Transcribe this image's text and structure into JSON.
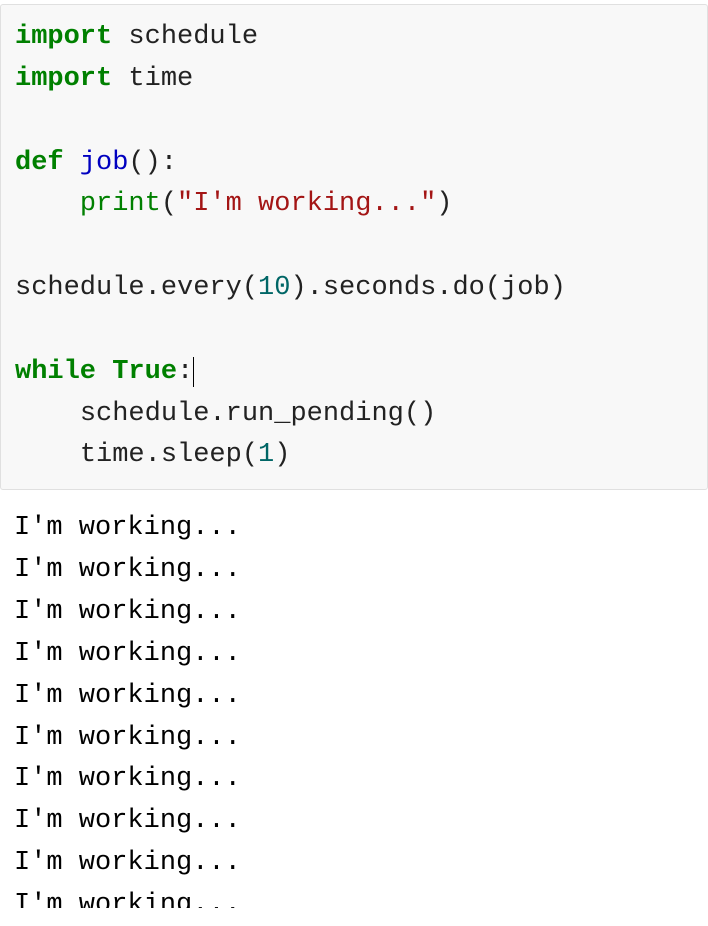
{
  "code": {
    "kw_import1": "import",
    "mod_schedule": " schedule",
    "kw_import2": "import",
    "mod_time": " time",
    "kw_def": "def",
    "fn_job": " job",
    "def_parens": "():",
    "indent1": "    ",
    "call_print": "print",
    "lparen1": "(",
    "str_msg": "\"I'm working...\"",
    "rparen1": ")",
    "sched_line": "schedule.every(",
    "num_ten": "10",
    "sched_line2": ").seconds.do(job)",
    "kw_while": "while",
    "sp_while": " ",
    "bool_true": "True",
    "colon_while": ":",
    "indent2a": "    ",
    "run_pending": "schedule.run_pending()",
    "indent2b": "    ",
    "sleep_pre": "time.sleep(",
    "num_one": "1",
    "sleep_post": ")"
  },
  "output": {
    "lines": [
      "I'm working...",
      "I'm working...",
      "I'm working...",
      "I'm working...",
      "I'm working...",
      "I'm working...",
      "I'm working...",
      "I'm working...",
      "I'm working...",
      "I'm working..."
    ]
  }
}
